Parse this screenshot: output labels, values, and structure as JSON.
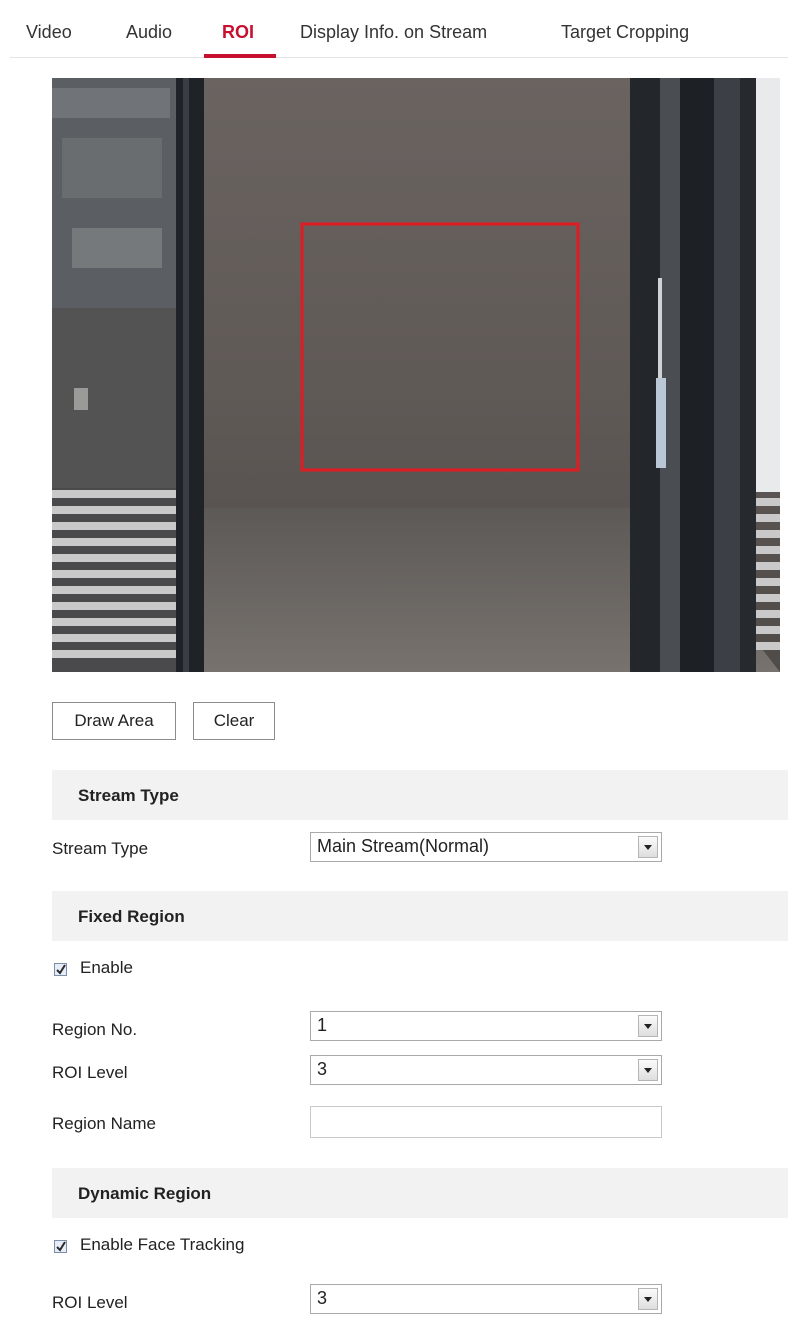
{
  "tabs": [
    {
      "label": "Video"
    },
    {
      "label": "Audio"
    },
    {
      "label": "ROI",
      "active": true
    },
    {
      "label": "Display Info. on Stream"
    },
    {
      "label": "Target Cropping"
    }
  ],
  "colors": {
    "accent": "#c8102e",
    "roi_box": "#e01b22",
    "section_bg": "#f2f2f2"
  },
  "preview": {
    "has_roi_rectangle": true
  },
  "buttons": {
    "draw_area": "Draw Area",
    "clear": "Clear"
  },
  "stream_type_section": {
    "header": "Stream Type",
    "stream_type_label": "Stream Type",
    "stream_type_value": "Main Stream(Normal)"
  },
  "fixed_region_section": {
    "header": "Fixed Region",
    "enable_label": "Enable",
    "enable_checked": true,
    "region_no_label": "Region No.",
    "region_no_value": "1",
    "roi_level_label": "ROI Level",
    "roi_level_value": "3",
    "region_name_label": "Region Name",
    "region_name_value": ""
  },
  "dynamic_region_section": {
    "header": "Dynamic Region",
    "face_tracking_label": "Enable Face Tracking",
    "face_tracking_checked": true,
    "roi_level_label": "ROI Level",
    "roi_level_value": "3"
  }
}
